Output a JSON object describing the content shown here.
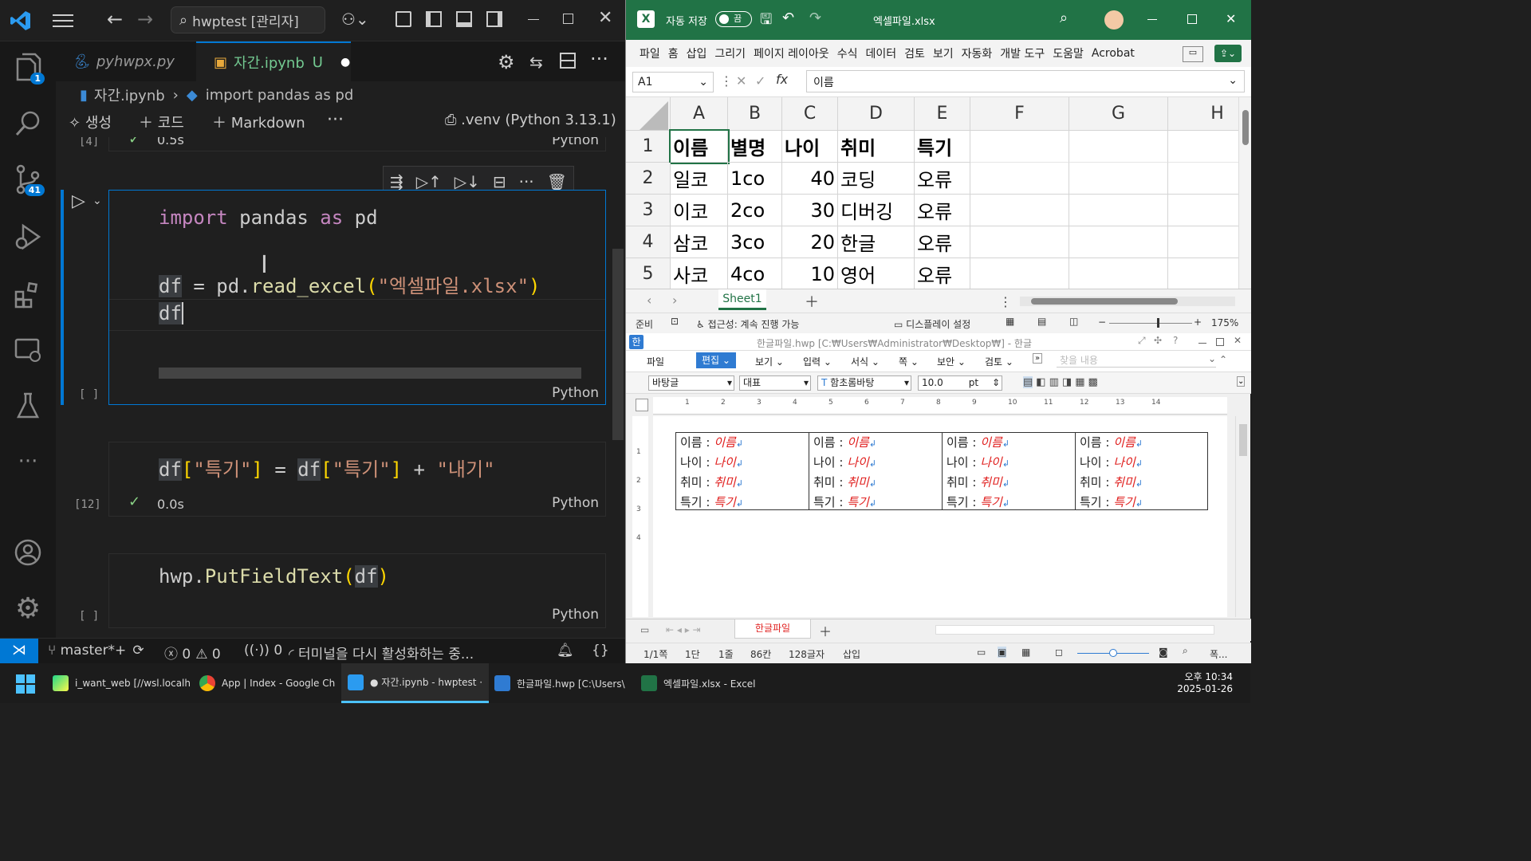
{
  "vscode": {
    "search": "hwptest [관리자]",
    "tabs": [
      {
        "label": "pyhwpx.py"
      },
      {
        "label": "자간.ipynb",
        "status": "U"
      }
    ],
    "breadcrumb": [
      "자간.ipynb",
      "import pandas as pd"
    ],
    "toolbar": {
      "generate": "생성",
      "code": "코드",
      "markdown": "Markdown",
      "kernel": ".venv (Python 3.13.1)"
    },
    "badges": {
      "explorer": "1",
      "scm": "41"
    },
    "prev_cell": {
      "count": "[4]",
      "time": "0.5s",
      "lang": "Python"
    },
    "cell1": {
      "line1": [
        "import",
        " pandas ",
        "as",
        " pd"
      ],
      "line2": [
        "df",
        " = pd.",
        "read_excel",
        "(",
        "\"엑셀파일.xlsx\"",
        ")"
      ],
      "line3": "df",
      "count": "[ ]",
      "lang": "Python"
    },
    "cell2": {
      "code": [
        "df",
        "[",
        "\"특기\"",
        "]",
        " = ",
        "df",
        "[",
        "\"특기\"",
        "]",
        " + ",
        "\"내기\""
      ],
      "count": "[12]",
      "time": "0.0s",
      "lang": "Python"
    },
    "cell3": {
      "code": [
        "hwp.",
        "PutFieldText",
        "(",
        "df",
        ")"
      ],
      "count": "[ ]",
      "lang": "Python"
    },
    "status": {
      "branch": "master*+",
      "errors": "0",
      "warnings": "0",
      "ports": "0",
      "message": "터미널을 다시 활성화하는 중..."
    }
  },
  "excel": {
    "autosave": "자동 저장",
    "autosave_state": "끔",
    "filename": "엑셀파일.xlsx",
    "menu": [
      "파일",
      "홈",
      "삽입",
      "그리기",
      "페이지 레이아웃",
      "수식",
      "데이터",
      "검토",
      "보기",
      "자동화",
      "개발 도구",
      "도움말",
      "Acrobat"
    ],
    "namebox": "A1",
    "formula": "이름",
    "cols": [
      "A",
      "B",
      "C",
      "D",
      "E",
      "F",
      "G",
      "H"
    ],
    "rows": [
      [
        "1",
        "이름",
        "별명",
        "나이",
        "취미",
        "특기"
      ],
      [
        "2",
        "일코",
        "1co",
        "40",
        "코딩",
        "오류"
      ],
      [
        "3",
        "이코",
        "2co",
        "30",
        "디버깅",
        "오류"
      ],
      [
        "4",
        "삼코",
        "3co",
        "20",
        "한글",
        "오류"
      ],
      [
        "5",
        "사코",
        "4co",
        "10",
        "영어",
        "오류"
      ]
    ],
    "sheet": "Sheet1",
    "status": {
      "ready": "준비",
      "access": "접근성: 계속 진행 가능",
      "display": "디스플레이 설정",
      "zoom": "175%"
    }
  },
  "hwp": {
    "title": "한글파일.hwp [C:₩Users₩Administrator₩Desktop₩] - 한글",
    "menu": [
      "파일",
      "편집",
      "보기",
      "입력",
      "서식",
      "쪽",
      "보안",
      "검토"
    ],
    "find": "찾을 내용",
    "style": "바탕글",
    "lang": "대표",
    "font": "함초롬바탕",
    "size": "10.0",
    "unit": "pt",
    "ruler": [
      "1",
      "2",
      "3",
      "4",
      "5",
      "6",
      "7",
      "8",
      "9",
      "10",
      "11",
      "12",
      "13",
      "14"
    ],
    "fields": [
      [
        "이름",
        "이름"
      ],
      [
        "나이",
        "나이"
      ],
      [
        "취미",
        "취미"
      ],
      [
        "특기",
        "특기"
      ]
    ],
    "sep": ":",
    "tab": "한글파일",
    "status": {
      "page": "1/1쪽",
      "section": "1단",
      "line": "1줄",
      "col": "86칸",
      "chars": "128글자",
      "mode": "삽입",
      "zoom": "폭..."
    }
  },
  "taskbar": {
    "items": [
      "i_want_web [//wsl.localh",
      "App | Index - Google Ch",
      "● 자간.ipynb - hwptest ·",
      "한글파일.hwp [C:\\Users\\",
      "엑셀파일.xlsx - Excel"
    ],
    "time": "오후 10:34",
    "date": "2025-01-26"
  }
}
